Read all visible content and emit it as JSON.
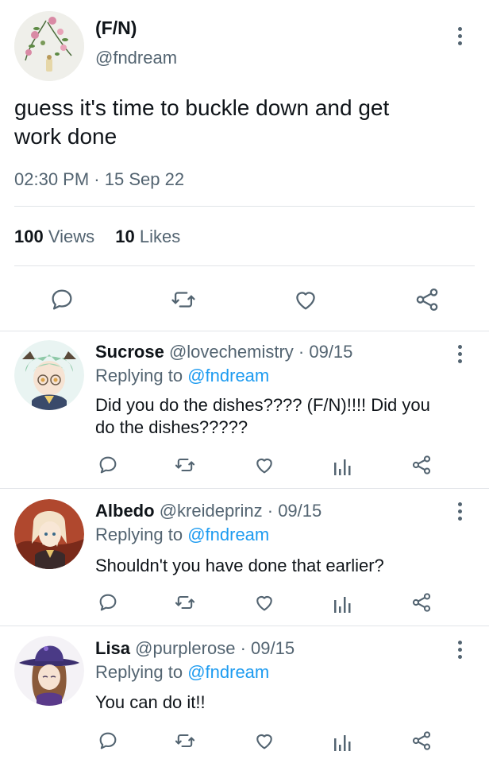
{
  "main_tweet": {
    "display_name": "(F/N)",
    "handle": "@fndream",
    "text_line1": "guess it's time to buckle down and get",
    "text_line2": "work done",
    "time": "02:30 PM",
    "separator": "·",
    "date": "15 Sep 22",
    "views_count": "100",
    "views_label": "Views",
    "likes_count": "10",
    "likes_label": "Likes"
  },
  "replies": [
    {
      "display_name": "Sucrose",
      "handle": "@lovechemistry",
      "date_sep": "· 09/15",
      "replying_prefix": "Replying to",
      "replying_handle": "@fndream",
      "text_line1": "Did you do the dishes???? (F/N)!!!! Did you",
      "text_line2": "do the dishes?????"
    },
    {
      "display_name": "Albedo",
      "handle": "@kreideprinz",
      "date_sep": "· 09/15",
      "replying_prefix": "Replying to",
      "replying_handle": "@fndream",
      "text_line1": "Shouldn't you have done that earlier?"
    },
    {
      "display_name": "Lisa",
      "handle": "@purplerose",
      "date_sep": "· 09/15",
      "replying_prefix": "Replying to",
      "replying_handle": "@fndream",
      "text_line1": "You can do it!!"
    }
  ],
  "colors": {
    "link": "#1d9bf0",
    "muted": "#536471",
    "text": "#0f1419",
    "divider": "#e1e4e8"
  },
  "icons": [
    "reply-icon",
    "retweet-icon",
    "like-icon",
    "views-icon",
    "share-icon",
    "more-icon"
  ]
}
